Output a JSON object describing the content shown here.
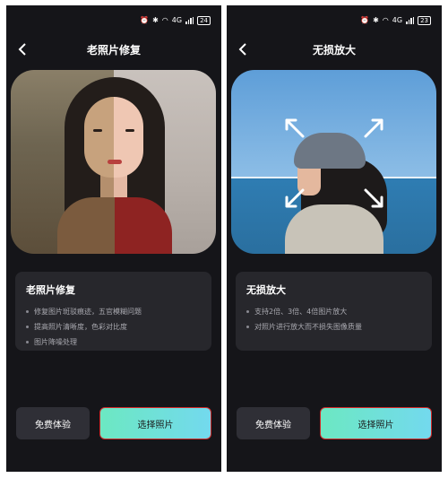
{
  "status_bar": {
    "left_battery": "24",
    "right_battery": "23",
    "network": "4G"
  },
  "screens": [
    {
      "title": "老照片修复",
      "card": {
        "heading": "老照片修复",
        "items": [
          "修复图片斑驳痕迹，五官模糊问题",
          "提高照片清晰度，色彩对比度",
          "图片降噪处理"
        ]
      },
      "buttons": {
        "free": "免费体验",
        "select": "选择照片"
      }
    },
    {
      "title": "无损放大",
      "card": {
        "heading": "无损放大",
        "items": [
          "支持2倍、3倍、4倍图片放大",
          "对照片进行放大而不损失图像质量"
        ]
      },
      "buttons": {
        "free": "免费体验",
        "select": "选择照片"
      }
    }
  ],
  "colors": {
    "background": "#151519",
    "card": "#27272c",
    "accent_start": "#6ce8c2",
    "accent_end": "#73d9ee"
  },
  "icons": [
    "back-arrow-icon",
    "expand-arrows-icon",
    "alarm-icon",
    "bluetooth-icon",
    "wifi-icon",
    "signal-icon",
    "battery-icon"
  ]
}
